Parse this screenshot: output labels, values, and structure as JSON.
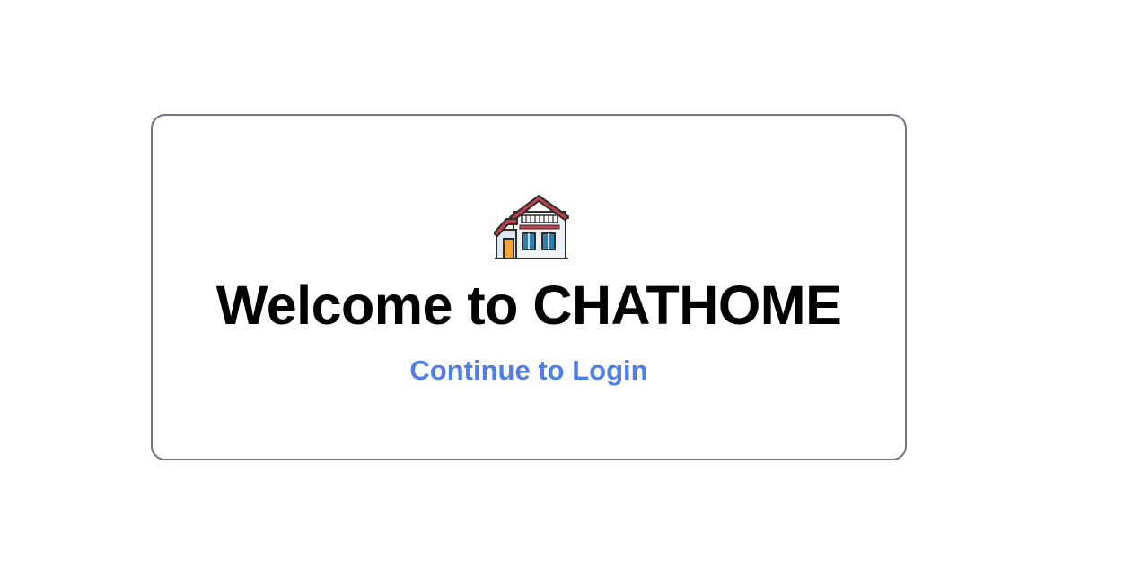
{
  "welcome": {
    "icon": "house-icon",
    "title": "Welcome to CHATHOME",
    "login_link": "Continue to Login",
    "link_color": "#4f7ee6"
  }
}
